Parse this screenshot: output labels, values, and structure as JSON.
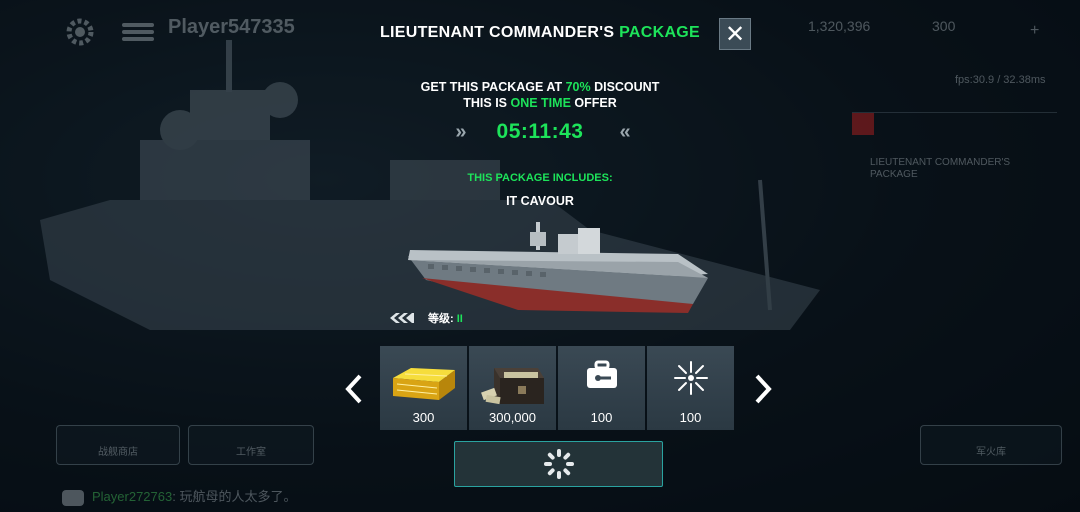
{
  "background": {
    "player_name": "Player547335",
    "resource_1": "1,320,396",
    "resource_2": "300",
    "plus": "+",
    "fps": "fps:30.9 / 32.38ms",
    "side_card_label": "LIEUTENANT COMMANDER'S PACKAGE",
    "btn_shop": "战舰商店",
    "btn_workshop": "工作室",
    "btn_right": "军火库",
    "chat_user": "Player272763",
    "chat_text": ": 玩航母的人太多了。"
  },
  "modal": {
    "title_main": "LIEUTENANT COMMANDER'S ",
    "title_accent": "PACKAGE",
    "close_symbol": "✕",
    "discount_prefix": "GET THIS PACKAGE AT ",
    "discount_value": "70%",
    "discount_suffix": " DISCOUNT",
    "offer_prefix": "THIS IS ",
    "offer_accent": "ONE TIME",
    "offer_suffix": " OFFER",
    "timer": "05:11:43",
    "timer_left_glyph": "»",
    "timer_right_glyph": "«",
    "includes_label": "THIS PACKAGE INCLUDES:",
    "ship_name": "IT CAVOUR",
    "tier_label": "等级:",
    "tier_value": "II",
    "items": [
      {
        "icon": "gold-bars-icon",
        "amount": "300"
      },
      {
        "icon": "money-chest-icon",
        "amount": "300,000"
      },
      {
        "icon": "toolbox-icon",
        "amount": "100"
      },
      {
        "icon": "starburst-icon",
        "amount": "100"
      }
    ]
  },
  "colors": {
    "accent_green": "#1de35a",
    "buy_border": "#2aa3a0"
  }
}
